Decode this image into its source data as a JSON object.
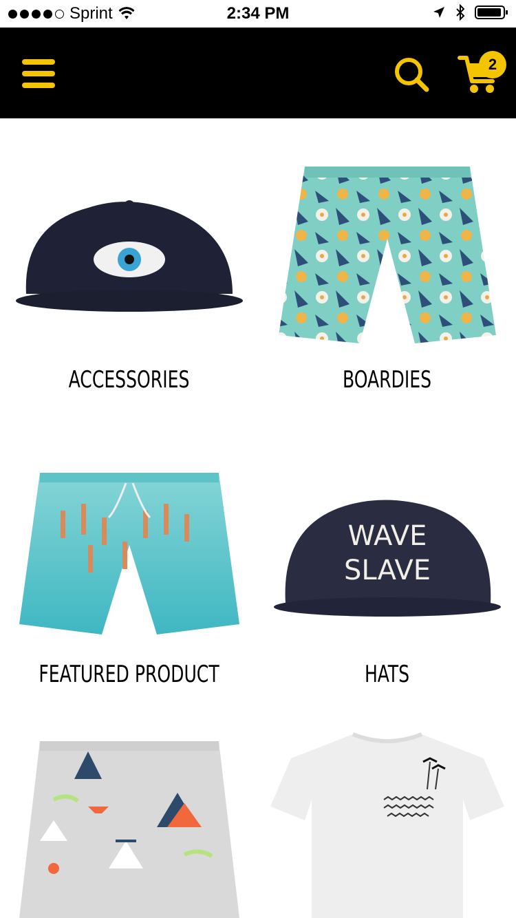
{
  "status_bar": {
    "carrier": "Sprint",
    "time": "2:34 PM",
    "signal_dots_filled": 4,
    "signal_dots_total": 5
  },
  "header": {
    "menu_icon": "hamburger-menu-icon",
    "search_icon": "search-icon",
    "cart_icon": "shopping-cart-icon",
    "cart_count": "2",
    "accent_color": "#f5c400",
    "bar_color": "#000000"
  },
  "categories": [
    {
      "label": "ACCESSORIES",
      "image": "navy cap with eye embroidery"
    },
    {
      "label": "BOARDIES",
      "image": "floral boardshorts"
    },
    {
      "label": "FEATURED PRODUCT",
      "image": "swimmer print shorts"
    },
    {
      "label": "HATS",
      "image": "navy cap"
    },
    {
      "label": "",
      "image": "teepee print boardshorts"
    },
    {
      "label": "",
      "image": "white tee"
    }
  ],
  "hat_text": {
    "line1": "WAVE",
    "line2": "SLAVE"
  }
}
